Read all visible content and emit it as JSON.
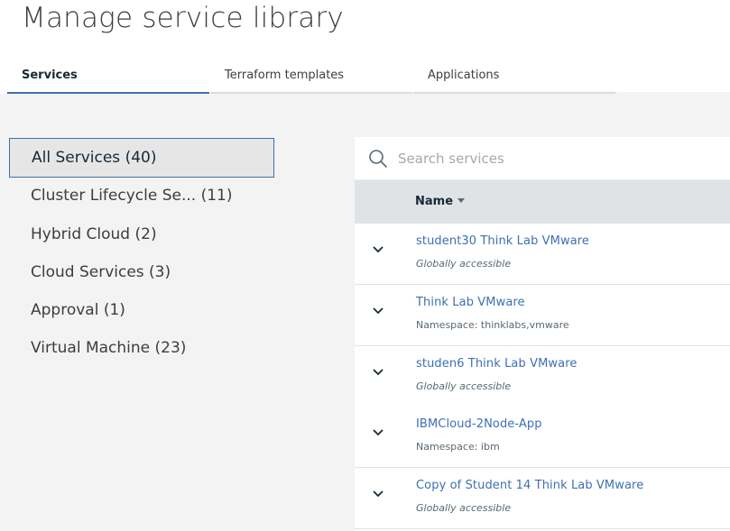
{
  "page": {
    "title": "Manage service library"
  },
  "tabs": [
    {
      "label": "Services",
      "active": true
    },
    {
      "label": "Terraform templates",
      "active": false
    },
    {
      "label": "Applications",
      "active": false
    }
  ],
  "sidebar": {
    "items": [
      {
        "label": "All Services (40)",
        "active": true
      },
      {
        "label": "Cluster Lifecycle Se... (11)",
        "active": false
      },
      {
        "label": "Hybrid Cloud (2)",
        "active": false
      },
      {
        "label": "Cloud Services (3)",
        "active": false
      },
      {
        "label": "Approval (1)",
        "active": false
      },
      {
        "label": "Virtual Machine (23)",
        "active": false
      }
    ]
  },
  "search": {
    "placeholder": "Search services",
    "value": ""
  },
  "table": {
    "columns": [
      {
        "label": "Name",
        "sort": "descending"
      }
    ],
    "rows": [
      {
        "title": "student30 Think Lab VMware",
        "subtitle": "Globally accessible",
        "subtitle_italic": true
      },
      {
        "title": "Think Lab VMware",
        "subtitle": "Namespace: thinklabs,vmware",
        "subtitle_italic": false
      },
      {
        "title": "studen6 Think Lab VMware",
        "subtitle": "Globally accessible",
        "subtitle_italic": true
      },
      {
        "title": "IBMCloud-2Node-App",
        "subtitle": "Namespace: ibm",
        "subtitle_italic": false
      },
      {
        "title": "Copy of Student 14 Think Lab VMware",
        "subtitle": "Globally accessible",
        "subtitle_italic": true
      }
    ]
  },
  "icons": {
    "search": "search-icon",
    "sort": "caret-down-icon",
    "expand": "chevron-down-icon"
  },
  "colors": {
    "accent": "#3d70b2",
    "link": "#3d70b2",
    "page_background": "#f3f3f3",
    "table_header": "#dfe3e6"
  }
}
